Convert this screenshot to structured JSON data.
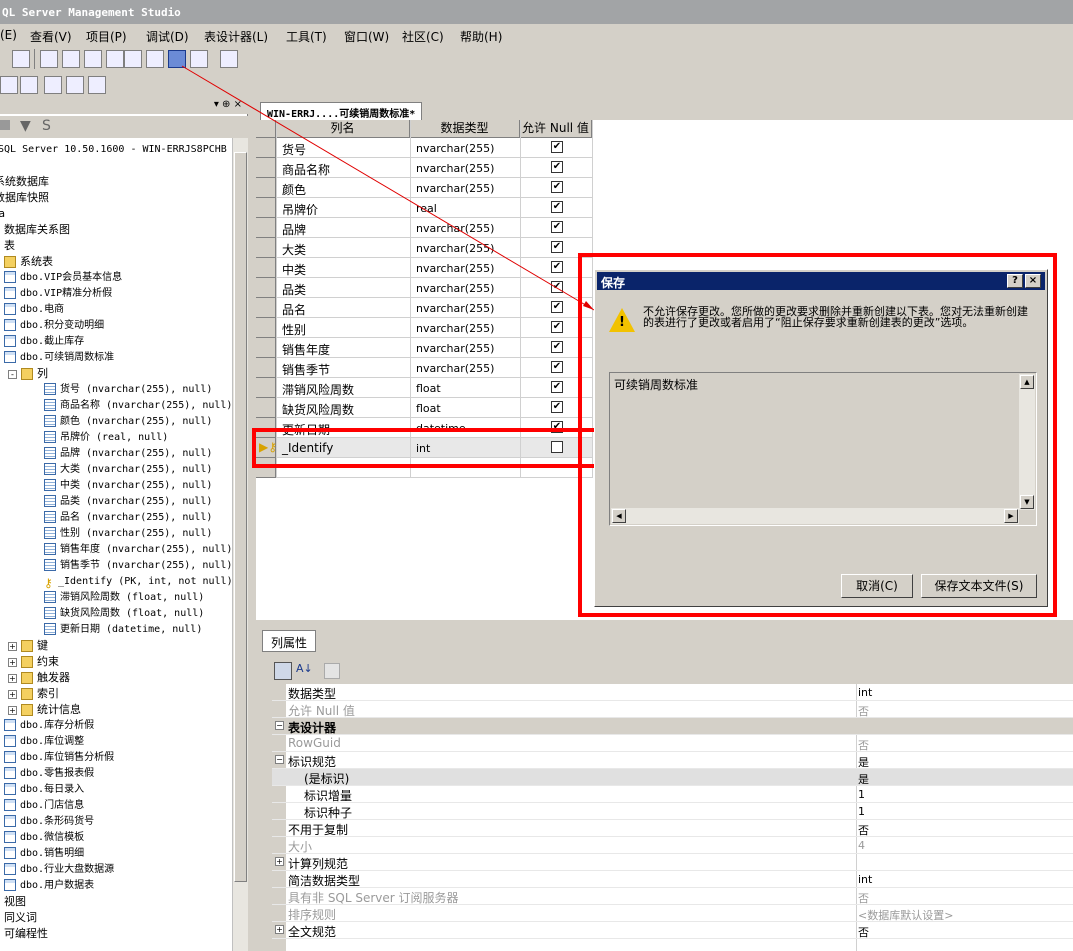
{
  "window": {
    "title": "QL Server Management Studio"
  },
  "menu": [
    "(E)",
    "查看(V)",
    "项目(P)",
    "调试(D)",
    "表设计器(L)",
    "工具(T)",
    "窗口(W)",
    "社区(C)",
    "帮助(H)"
  ],
  "object_explorer": {
    "pin": "▾ ⊕ ×",
    "server": "SQL Server 10.50.1600 - WIN-ERRJS8PCHB",
    "items": [
      "系统数据库",
      "数据库快照",
      "ta",
      "数据库关系图",
      "表",
      "系统表",
      "dbo.VIP会员基本信息",
      "dbo.VIP精准分析假",
      "dbo.电商",
      "dbo.积分变动明细",
      "dbo.截止库存",
      "dbo.可续销周数标准",
      "列"
    ],
    "columns": [
      "货号 (nvarchar(255), null)",
      "商品名称 (nvarchar(255), null)",
      "颜色 (nvarchar(255), null)",
      "吊牌价 (real, null)",
      "品牌 (nvarchar(255), null)",
      "大类 (nvarchar(255), null)",
      "中类 (nvarchar(255), null)",
      "品类 (nvarchar(255), null)",
      "品名 (nvarchar(255), null)",
      "性别 (nvarchar(255), null)",
      "销售年度 (nvarchar(255), null)",
      "销售季节 (nvarchar(255), null)",
      "_Identify (PK, int, not null)",
      "滞销风险周数 (float, null)",
      "缺货风险周数 (float, null)",
      "更新日期 (datetime, null)"
    ],
    "folders": [
      "键",
      "约束",
      "触发器",
      "索引",
      "统计信息"
    ],
    "tables2": [
      "dbo.库存分析假",
      "dbo.库位调整",
      "dbo.库位销售分析假",
      "dbo.零售报表假",
      "dbo.每日录入",
      "dbo.门店信息",
      "dbo.条形码货号",
      "dbo.微信模板",
      "dbo.销售明细",
      "dbo.行业大盘数据源",
      "dbo.用户数据表"
    ],
    "bottom": [
      "视图",
      "同义词",
      "可编程性"
    ]
  },
  "designer": {
    "tab": "WIN-ERRJ....可续销周数标准*",
    "headers": [
      "列名",
      "数据类型",
      "允许 Null 值"
    ],
    "rows": [
      {
        "name": "货号",
        "type": "nvarchar(255)",
        "null": "✔"
      },
      {
        "name": "商品名称",
        "type": "nvarchar(255)",
        "null": "✔"
      },
      {
        "name": "颜色",
        "type": "nvarchar(255)",
        "null": "✔"
      },
      {
        "name": "吊牌价",
        "type": "real",
        "null": "✔"
      },
      {
        "name": "品牌",
        "type": "nvarchar(255)",
        "null": "✔"
      },
      {
        "name": "大类",
        "type": "nvarchar(255)",
        "null": "✔"
      },
      {
        "name": "中类",
        "type": "nvarchar(255)",
        "null": "✔"
      },
      {
        "name": "品类",
        "type": "nvarchar(255)",
        "null": "✔"
      },
      {
        "name": "品名",
        "type": "nvarchar(255)",
        "null": "✔"
      },
      {
        "name": "性别",
        "type": "nvarchar(255)",
        "null": "✔"
      },
      {
        "name": "销售年度",
        "type": "nvarchar(255)",
        "null": "✔"
      },
      {
        "name": "销售季节",
        "type": "nvarchar(255)",
        "null": "✔"
      },
      {
        "name": "滞销风险周数",
        "type": "float",
        "null": "✔"
      },
      {
        "name": "缺货风险周数",
        "type": "float",
        "null": "✔"
      },
      {
        "name": "更新日期",
        "type": "datetime",
        "null": "✔"
      },
      {
        "name": "_Identify",
        "type": "int",
        "null": ""
      }
    ]
  },
  "properties": {
    "tab": "列属性",
    "rows": [
      {
        "n": "数据类型",
        "v": "int",
        "kind": ""
      },
      {
        "n": "允许 Null 值",
        "v": "否",
        "kind": "dis"
      },
      {
        "n": "表设计器",
        "v": "",
        "kind": "cat"
      },
      {
        "n": "RowGuid",
        "v": "否",
        "kind": "dis"
      },
      {
        "n": "标识规范",
        "v": "是",
        "kind": "exp"
      },
      {
        "n": "(是标识)",
        "v": "是",
        "kind": "hi"
      },
      {
        "n": "标识增量",
        "v": "1",
        "kind": "sub"
      },
      {
        "n": "标识种子",
        "v": "1",
        "kind": "sub"
      },
      {
        "n": "不用于复制",
        "v": "否",
        "kind": ""
      },
      {
        "n": "大小",
        "v": "4",
        "kind": "dis"
      },
      {
        "n": "计算列规范",
        "v": "",
        "kind": "exp"
      },
      {
        "n": "简洁数据类型",
        "v": "int",
        "kind": ""
      },
      {
        "n": "具有非 SQL Server 订阅服务器",
        "v": "否",
        "kind": "dis"
      },
      {
        "n": "排序规则",
        "v": "<数据库默认设置>",
        "kind": "dis"
      },
      {
        "n": "全文规范",
        "v": "否",
        "kind": "exp"
      }
    ]
  },
  "dialog": {
    "title": "保存",
    "help": "?",
    "close": "×",
    "message": "不允许保存更改。您所做的更改要求删除并重新创建以下表。您对无法重新创建的表进行了更改或者启用了“阻止保存要求重新创建表的更改”选项。",
    "list_item": "可续销周数标准",
    "cancel": "取消(C)",
    "save_text": "保存文本文件(S)"
  }
}
